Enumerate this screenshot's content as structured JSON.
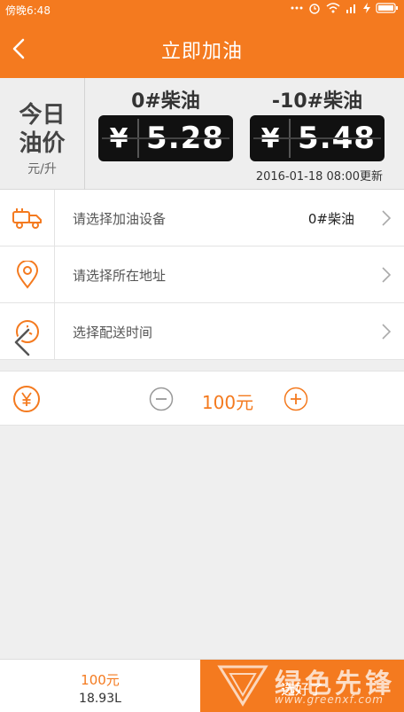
{
  "status_bar": {
    "time": "傍晚6:48"
  },
  "nav": {
    "title": "立即加油"
  },
  "price_panel": {
    "today_line1": "今日",
    "today_line2": "油价",
    "unit": "元/升",
    "fuels": [
      {
        "name": "0#柴油",
        "currency": "¥",
        "price": "5.28"
      },
      {
        "name": "-10#柴油",
        "currency": "¥",
        "price": "5.48"
      }
    ],
    "updated": "2016-01-18 08:00更新"
  },
  "form": {
    "equipment_label": "请选择加油设备",
    "equipment_value": "0#柴油",
    "address_label": "请选择所在地址",
    "time_label": "选择配送时间"
  },
  "amount": {
    "value": "100元"
  },
  "bottom": {
    "total": "100元",
    "liters": "18.93L",
    "confirm_label": "选好了"
  },
  "watermark": {
    "brand": "绿色先锋",
    "url": "www.greenxf.com"
  },
  "colors": {
    "accent": "#f47a1f"
  }
}
